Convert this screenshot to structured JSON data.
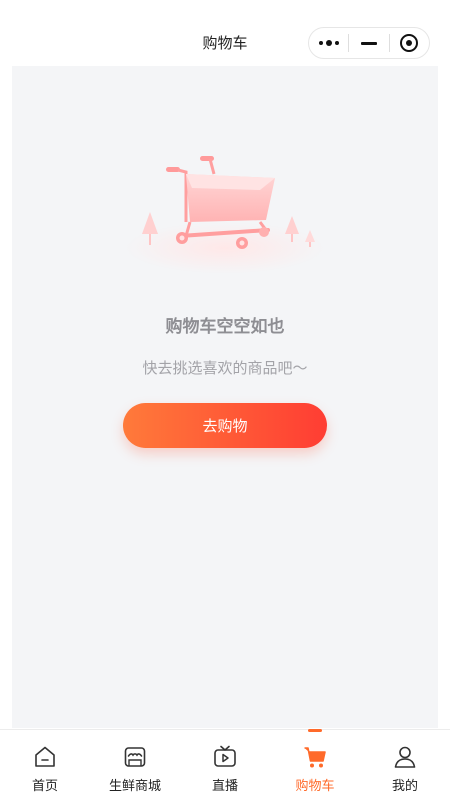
{
  "nav": {
    "title": "购物车"
  },
  "empty": {
    "title": "购物车空空如也",
    "subtitle": "快去挑选喜欢的商品吧～",
    "button_label": "去购物"
  },
  "tabbar": {
    "items": [
      {
        "label": "首页",
        "icon": "home-icon"
      },
      {
        "label": "生鲜商城",
        "icon": "store-icon"
      },
      {
        "label": "直播",
        "icon": "tv-play-icon"
      },
      {
        "label": "购物车",
        "icon": "cart-icon",
        "active": true
      },
      {
        "label": "我的",
        "icon": "user-icon"
      }
    ]
  },
  "colors": {
    "accent": "#ff6a2a",
    "button_gradient_start": "#ff7a3a",
    "button_gradient_end": "#ff3d33",
    "page_background": "#f4f5f7"
  }
}
